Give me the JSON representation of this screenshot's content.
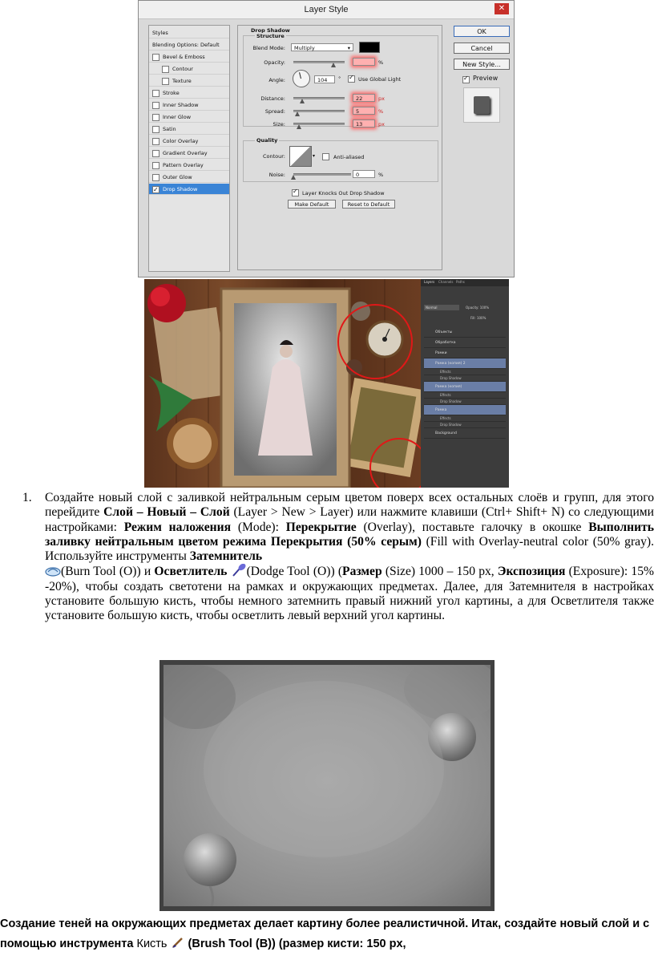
{
  "dialog": {
    "title": "Layer Style",
    "close_icon": "close-icon",
    "styles_items": [
      {
        "label": "Styles",
        "checkbox": false,
        "indent": false,
        "checked": false,
        "selected": false
      },
      {
        "label": "Blending Options: Default",
        "checkbox": false,
        "indent": false,
        "checked": false,
        "selected": false
      },
      {
        "label": "Bevel & Emboss",
        "checkbox": true,
        "indent": false,
        "checked": false,
        "selected": false
      },
      {
        "label": "Contour",
        "checkbox": true,
        "indent": true,
        "checked": false,
        "selected": false
      },
      {
        "label": "Texture",
        "checkbox": true,
        "indent": true,
        "checked": false,
        "selected": false
      },
      {
        "label": "Stroke",
        "checkbox": true,
        "indent": false,
        "checked": false,
        "selected": false
      },
      {
        "label": "Inner Shadow",
        "checkbox": true,
        "indent": false,
        "checked": false,
        "selected": false
      },
      {
        "label": "Inner Glow",
        "checkbox": true,
        "indent": false,
        "checked": false,
        "selected": false
      },
      {
        "label": "Satin",
        "checkbox": true,
        "indent": false,
        "checked": false,
        "selected": false
      },
      {
        "label": "Color Overlay",
        "checkbox": true,
        "indent": false,
        "checked": false,
        "selected": false
      },
      {
        "label": "Gradient Overlay",
        "checkbox": true,
        "indent": false,
        "checked": false,
        "selected": false
      },
      {
        "label": "Pattern Overlay",
        "checkbox": true,
        "indent": false,
        "checked": false,
        "selected": false
      },
      {
        "label": "Outer Glow",
        "checkbox": true,
        "indent": false,
        "checked": false,
        "selected": false
      },
      {
        "label": "Drop Shadow",
        "checkbox": true,
        "indent": false,
        "checked": true,
        "selected": true
      }
    ],
    "section_title": "Drop Shadow",
    "structure_title": "Structure",
    "blend_mode_label": "Blend Mode:",
    "blend_mode_value": "Multiply",
    "shadow_color": "#000000",
    "opacity_label": "Opacity:",
    "opacity_value": "",
    "opacity_unit": "%",
    "angle_label": "Angle:",
    "angle_value": "104",
    "angle_unit": "°",
    "use_global_light_label": "Use Global Light",
    "use_global_light_checked": true,
    "distance_label": "Distance:",
    "distance_value": "22",
    "distance_unit": "px",
    "spread_label": "Spread:",
    "spread_value": "5",
    "spread_unit": "%",
    "size_label": "Size:",
    "size_value": "13",
    "size_unit": "px",
    "quality_title": "Quality",
    "contour_label": "Contour:",
    "anti_aliased_label": "Anti-aliased",
    "noise_label": "Noise:",
    "noise_value": "0",
    "noise_unit": "%",
    "knocks_out_label": "Layer Knocks Out Drop Shadow",
    "make_default_label": "Make Default",
    "reset_default_label": "Reset to Default",
    "ok_label": "OK",
    "cancel_label": "Cancel",
    "new_style_label": "New Style...",
    "preview_label": "Preview",
    "highlight_color": "#ff6060",
    "selected_color": "#3a84d6"
  },
  "ps": {
    "panel_tabs": [
      "Layers",
      "Channels",
      "Paths"
    ],
    "blend_value": "Normal",
    "opacity_text": "Opacity: 100%",
    "fill_text": "Fill: 100%",
    "layers": [
      {
        "label": "Объекты",
        "kind": "group"
      },
      {
        "label": "Обработка",
        "kind": "group"
      },
      {
        "label": "Рамки",
        "kind": "group"
      },
      {
        "label": "Рамка (копия) 2",
        "kind": "layer"
      },
      {
        "label": "Effects",
        "kind": "sub"
      },
      {
        "label": "Drop Shadow",
        "kind": "sub"
      },
      {
        "label": "Рамка (копия)",
        "kind": "layer"
      },
      {
        "label": "Effects",
        "kind": "sub"
      },
      {
        "label": "Drop Shadow",
        "kind": "sub"
      },
      {
        "label": "Рамка",
        "kind": "layer"
      },
      {
        "label": "Effects",
        "kind": "sub"
      },
      {
        "label": "Drop Shadow",
        "kind": "sub"
      },
      {
        "label": "Background",
        "kind": "bg"
      }
    ]
  },
  "step": {
    "number": "1.",
    "t1": "Создайте новый слой с заливкой нейтральным серым цветом поверх всех остальных слоёв и групп, для этого перейдите ",
    "b1": "Слой – Новый – Слой",
    "t2": " (Layer > New > Layer) или нажмите клавиши (Ctrl+ Shift+ N) со следующими настройками: ",
    "b2": "Режим наложения",
    "t3": " (Mode): ",
    "b3": "Перекрытие",
    "t4": " (Overlay), поставьте галочку в окошке ",
    "b4": "Выполнить заливку нейтральным цветом режима Перекрытия (50% серым)",
    "t5": " (Fill with Overlay-neutral color (50% gray). Используйте инструменты ",
    "b5": "Затемнитель",
    "t6": "(Burn Tool (O)) и ",
    "b6": "Осветлитель",
    "t7": "(Dodge Tool (O)) (",
    "b7": "Размер",
    "t8": " (Size) 1000 – 150 px, ",
    "b8": "Экспозиция",
    "t9": " (Exposure): 15% -20%), чтобы создать светотени на рамках и окружающих предметах. Далее, для Затемнителя в настройках установите большую кисть, чтобы немного затемнить правый нижний угол картины, а для Осветлителя также установите большую кисть, чтобы осветлить левый верхний угол картины."
  },
  "caption": {
    "b1": "Создание теней на окружающих предметах делает картину более реалистичной. Итак, создайте новый слой и с помощью инструмента ",
    "n1": "Кисть",
    "b2": " (Brush Tool (B)) (размер кисти: 150 px,"
  }
}
